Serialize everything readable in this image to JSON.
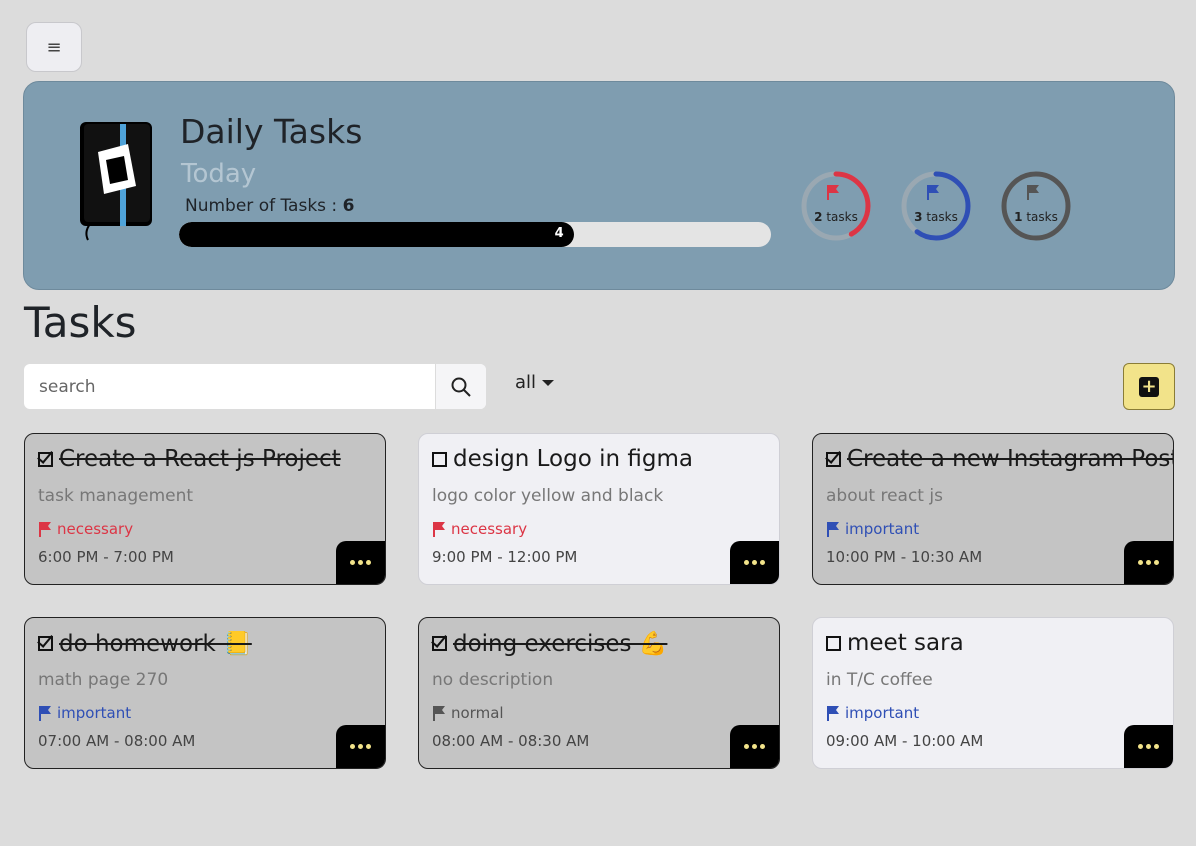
{
  "menu": {
    "icon": "hamburger-icon",
    "glyph": "≡"
  },
  "header": {
    "title": "Daily Tasks",
    "subtitle": "Today",
    "count_label": "Number of Tasks : ",
    "count_value": "6",
    "progress": {
      "label": "4",
      "value": 4,
      "total": 6
    }
  },
  "summary": [
    {
      "count": "2",
      "unit": " tasks",
      "priority": "necessary",
      "color": "#dc3545",
      "fraction": 0.42
    },
    {
      "count": "3",
      "unit": " tasks",
      "priority": "important",
      "color": "#2f4fb5",
      "fraction": 0.6
    },
    {
      "count": "1",
      "unit": " tasks",
      "priority": "normal",
      "color": "#555555",
      "fraction": 1.0
    }
  ],
  "section_title": "Tasks",
  "search": {
    "placeholder": "search",
    "value": ""
  },
  "filter": {
    "selected": "all"
  },
  "add_button": {
    "icon": "plus-icon",
    "glyph": "+"
  },
  "colors": {
    "necessary": "#dc3545",
    "important": "#2f4fb5",
    "normal": "#555555",
    "accent": "#f2e38a"
  },
  "tasks": [
    {
      "title": "Create a React js Project",
      "desc": "task management",
      "priority": "necessary",
      "time": "6:00 PM - 7:00 PM",
      "done": true,
      "emoji": ""
    },
    {
      "title": "design Logo in figma",
      "desc": "logo color yellow and black",
      "priority": "necessary",
      "time": "9:00 PM - 12:00 PM",
      "done": false,
      "emoji": ""
    },
    {
      "title": "Create a new Instagram Post",
      "desc": "about react js",
      "priority": "important",
      "time": "10:00 PM - 10:30 AM",
      "done": true,
      "emoji": ""
    },
    {
      "title": "do homework",
      "desc": "math page 270",
      "priority": "important",
      "time": "07:00 AM - 08:00 AM",
      "done": true,
      "emoji": "📒"
    },
    {
      "title": "doing exercises",
      "desc": "no description",
      "priority": "normal",
      "time": "08:00 AM - 08:30 AM",
      "done": true,
      "emoji": "💪"
    },
    {
      "title": "meet sara",
      "desc": "in T/C coffee",
      "priority": "important",
      "time": "09:00 AM - 10:00 AM",
      "done": false,
      "emoji": ""
    }
  ]
}
